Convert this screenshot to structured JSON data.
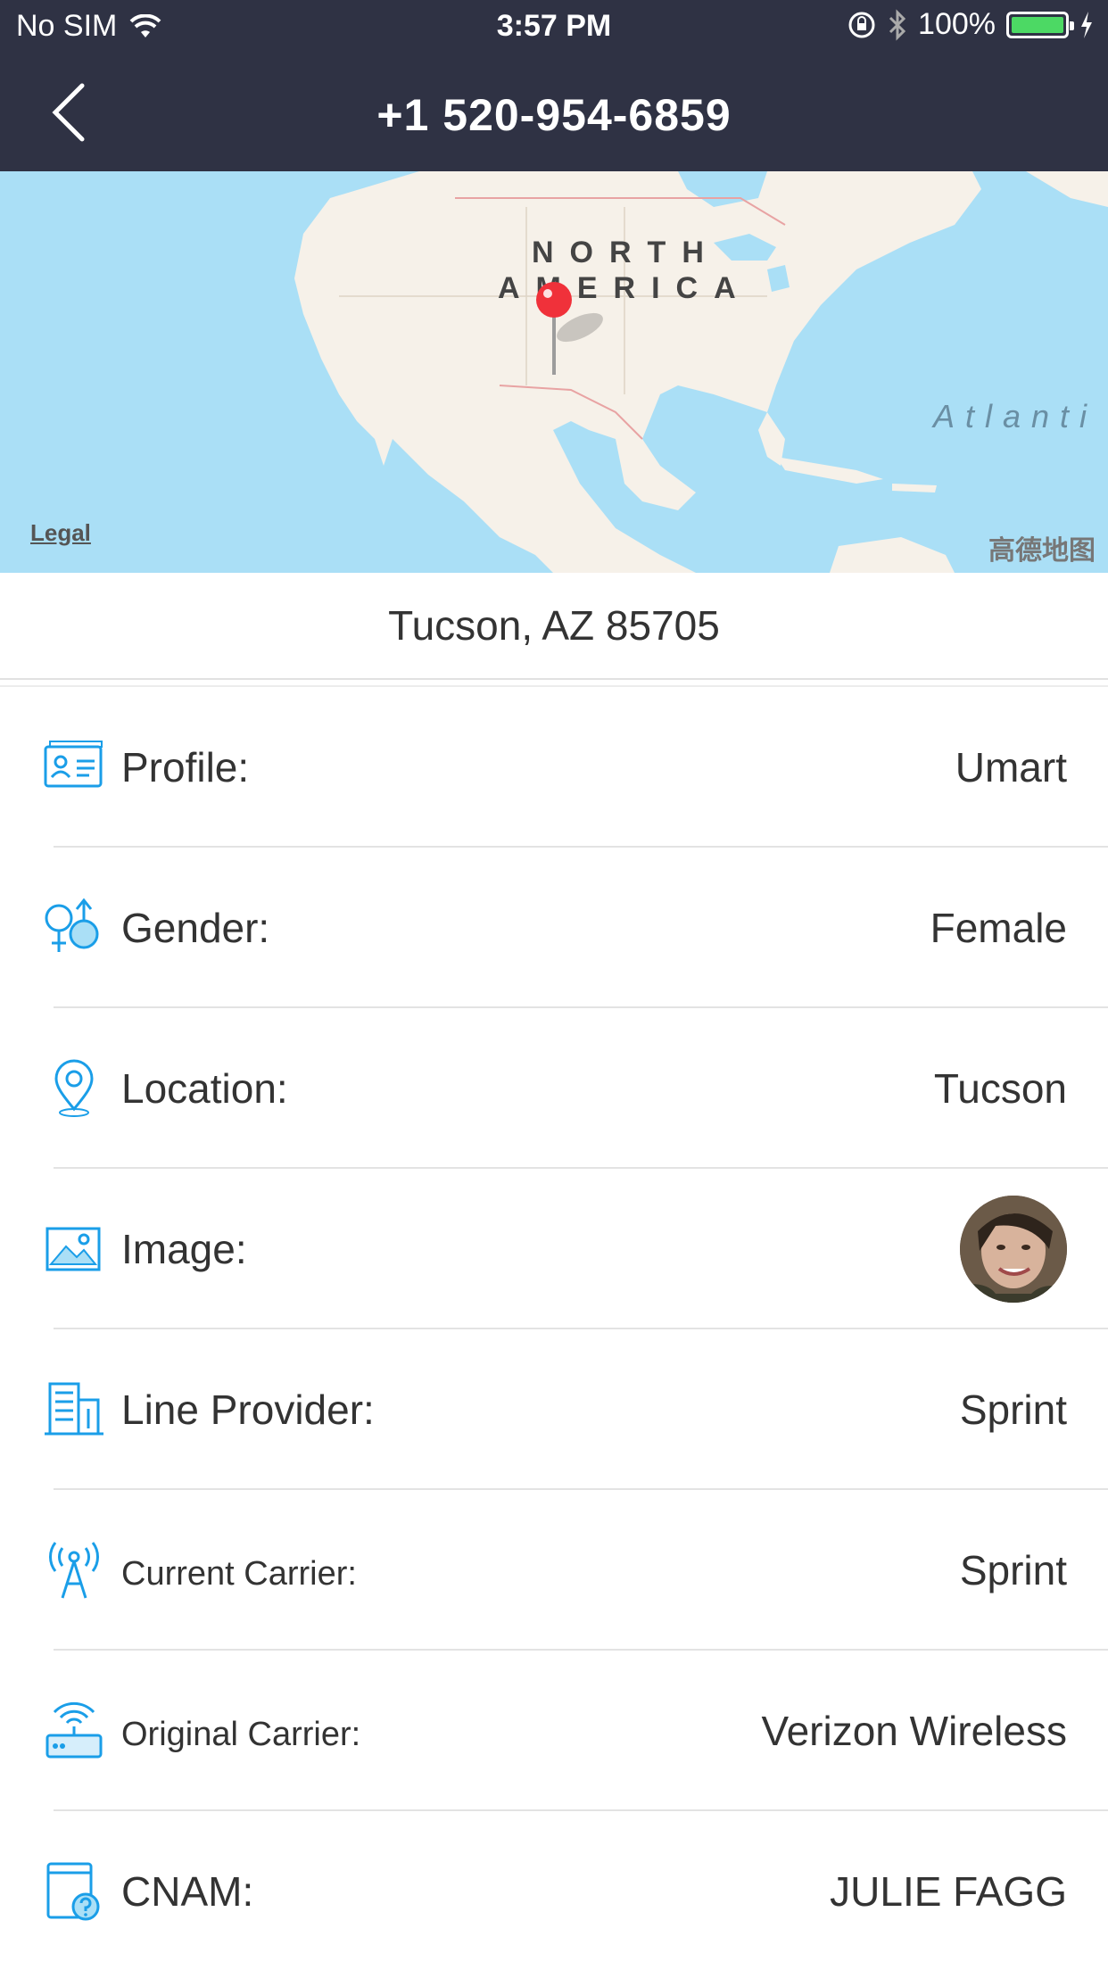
{
  "status_bar": {
    "carrier": "No SIM",
    "time": "3:57 PM",
    "battery": "100%"
  },
  "nav": {
    "title": "+1 520-954-6859"
  },
  "map": {
    "continent_line1": "NORTH",
    "continent_line2": "AMERICA",
    "ocean": "Atlanti",
    "legal": "Legal",
    "brand": "高德地图"
  },
  "address": "Tucson, AZ 85705",
  "rows": [
    {
      "label": "Profile:",
      "value": "Umart",
      "icon": "profile-card-icon"
    },
    {
      "label": "Gender:",
      "value": "Female",
      "icon": "gender-icon"
    },
    {
      "label": "Location:",
      "value": "Tucson",
      "icon": "location-pin-icon"
    },
    {
      "label": "Image:",
      "value": "",
      "icon": "image-icon"
    },
    {
      "label": "Line Provider:",
      "value": "Sprint",
      "icon": "building-icon"
    },
    {
      "label": "Current Carrier:",
      "value": "Sprint",
      "icon": "antenna-tower-icon"
    },
    {
      "label": "Original Carrier:",
      "value": "Verizon Wireless",
      "icon": "router-icon"
    },
    {
      "label": "CNAM:",
      "value": "JULIE FAGG",
      "icon": "caller-id-icon"
    }
  ],
  "colors": {
    "nav_background": "#2f3244",
    "icon_blue": "#1a9ee8",
    "map_water": "#aadff6",
    "map_land": "#f6f1e9",
    "pin_red": "#f0313a"
  }
}
